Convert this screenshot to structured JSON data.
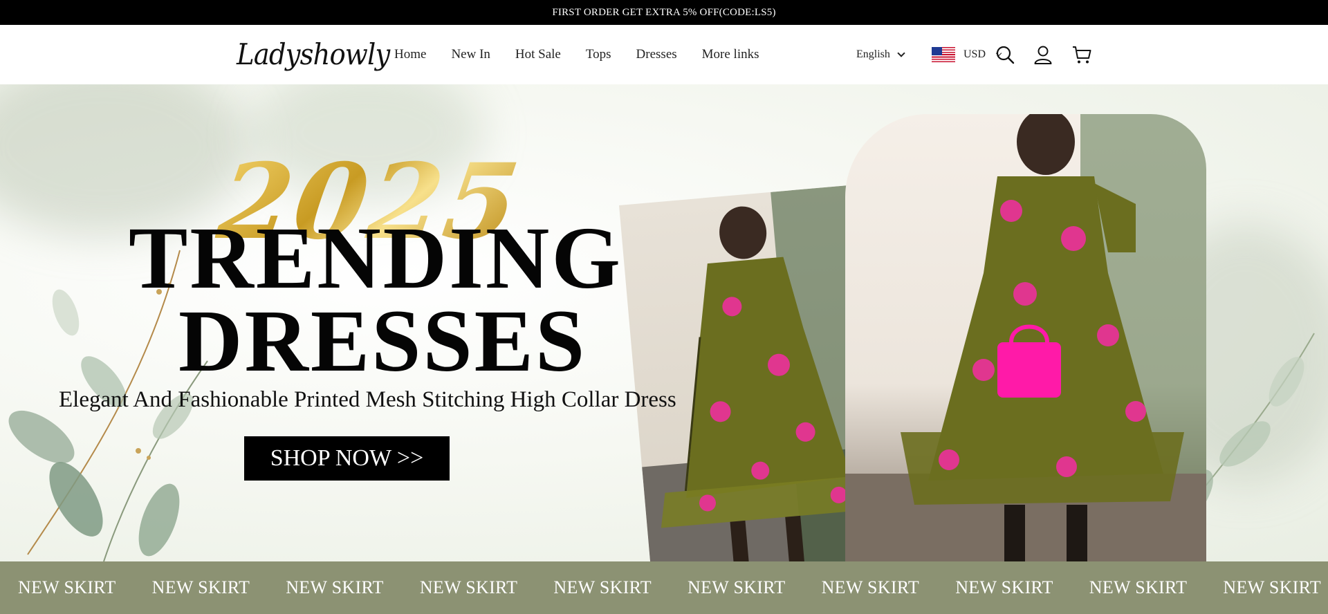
{
  "announcement": {
    "text": "FIRST ORDER GET EXTRA 5% OFF(CODE:LS5)"
  },
  "header": {
    "logo": "Ladyshowly",
    "nav": [
      "Home",
      "New In",
      "Hot Sale",
      "Tops",
      "Dresses",
      "More links"
    ],
    "language": "English",
    "currency": "USD",
    "icons": [
      "search-icon",
      "account-icon",
      "cart-icon"
    ]
  },
  "hero": {
    "year": "2025",
    "title_line1": "TRENDING",
    "title_line2": "DRESSES",
    "subtitle": "Elegant And Fashionable Printed Mesh Stitching High Collar Dress",
    "cta": "SHOP NOW >>"
  },
  "ticker": {
    "items": [
      "NEW SKIRT",
      "NEW SKIRT",
      "NEW SKIRT",
      "NEW SKIRT",
      "NEW SKIRT",
      "NEW SKIRT",
      "NEW SKIRT",
      "NEW SKIRT",
      "NEW SKIRT",
      "NEW SKIRT"
    ]
  },
  "colors": {
    "ticker_bg": "#8c9273",
    "announce_bg": "#000000",
    "gold": "#c89b23",
    "dress_green": "#6b6e1f",
    "dress_pink": "#e0368f"
  }
}
